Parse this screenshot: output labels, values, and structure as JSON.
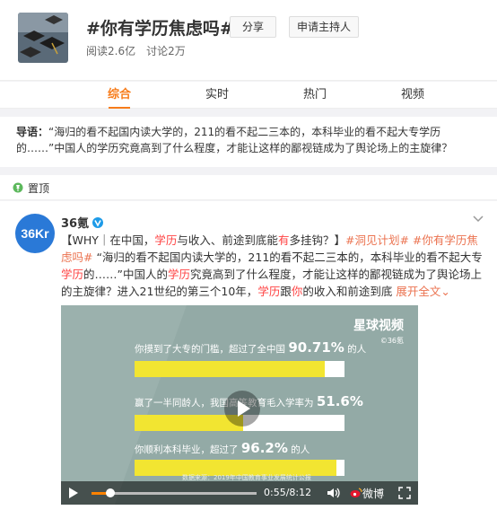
{
  "topic": {
    "title": "#你有学历焦虑吗#",
    "reads": "阅读2.6亿",
    "discussions": "讨论2万",
    "share_label": "分享",
    "host_label": "申请主持人"
  },
  "tabs": [
    {
      "label": "综合",
      "active": true
    },
    {
      "label": "实时",
      "active": false
    },
    {
      "label": "热门",
      "active": false
    },
    {
      "label": "视频",
      "active": false
    }
  ],
  "intro": {
    "prefix": "导语：",
    "text": "“海归的看不起国内读大学的，211的看不起二三本的，本科毕业的看不起大专学历的……”中国人的学历究竟高到了什么程度，才能让这样的鄙视链成为了舆论场上的主旋律？"
  },
  "pinned": {
    "label": "置顶"
  },
  "post": {
    "author": "36氪",
    "avatar_text": "36Kr",
    "text_parts": [
      {
        "t": "【WHY｜在中国，",
        "k": "n"
      },
      {
        "t": "学历",
        "k": "h"
      },
      {
        "t": "与收入、前途到底能",
        "k": "n"
      },
      {
        "t": "有",
        "k": "h"
      },
      {
        "t": "多挂钩？】",
        "k": "n"
      },
      {
        "t": "#洞见计划#",
        "k": "t"
      },
      {
        "t": " ",
        "k": "n"
      },
      {
        "t": "#你有学历焦虑吗#",
        "k": "t"
      },
      {
        "t": " “海归的看不起国内读大学的，211的看不起二三本的，本科毕业的看不起大专",
        "k": "n"
      },
      {
        "t": "学历",
        "k": "h"
      },
      {
        "t": "的……”中国人的",
        "k": "n"
      },
      {
        "t": "学历",
        "k": "h"
      },
      {
        "t": "究竟高到了什么程度，才能让这样的鄙视链成为了舆论场上的主旋律？进入21世纪的第三个10年，",
        "k": "n"
      },
      {
        "t": "学历",
        "k": "h"
      },
      {
        "t": "跟",
        "k": "n"
      },
      {
        "t": "你",
        "k": "h"
      },
      {
        "t": "的收入和前途到底 ",
        "k": "n"
      }
    ],
    "expand_label": "展开全文⌄"
  },
  "video": {
    "brand": "星球视频",
    "brand_sub": "©36氪",
    "lines": [
      {
        "text": "你摸到了大专的门槛，超过了全中国",
        "value": "90.71%",
        "suffix": "的人",
        "fraction": 0.9071
      },
      {
        "text": "赢了一半同龄人，我国高等教育毛入学率为",
        "value": "51.6%",
        "suffix": "",
        "fraction": 0.516
      },
      {
        "text": "你顺利本科毕业，超过了",
        "value": "96.2%",
        "suffix": "的人",
        "fraction": 0.962
      }
    ],
    "source": "数据来源：2019年中国教育事业发展统计公报",
    "time": "0:55/8:12",
    "progress": 0.112,
    "weibo_label": "微博"
  },
  "colors": {
    "accent": "#f77c1b",
    "highlight": "#ff4444",
    "topic_link": "#eb7350",
    "video_bg": "#93aaa6",
    "bar_fill": "#f2e531"
  }
}
